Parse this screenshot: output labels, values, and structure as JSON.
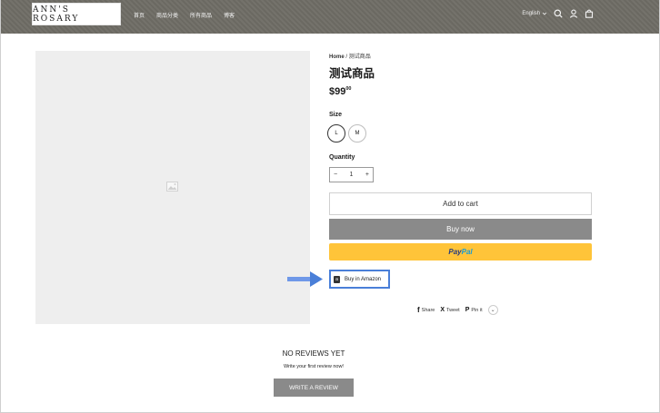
{
  "header": {
    "logo": "ANN'S ROSARY",
    "nav": [
      "首页",
      "商品分类",
      "所有商品",
      "博客"
    ],
    "language": "English",
    "icons": [
      "search-icon",
      "account-icon",
      "cart-icon"
    ]
  },
  "breadcrumb": {
    "home": "Home",
    "separator": "/",
    "current": "测试商品"
  },
  "product": {
    "title": "测试商品",
    "price_main": "$99",
    "price_cents": "00",
    "size_label": "Size",
    "sizes": [
      "L",
      "M"
    ],
    "selected_size": "L",
    "quantity_label": "Quantity",
    "qty_minus": "−",
    "qty_plus": "+",
    "quantity": "1"
  },
  "buttons": {
    "add_to_cart": "Add to cart",
    "buy_now": "Buy now",
    "paypal_pay": "Pay",
    "paypal_pal": "Pal",
    "amazon": "Buy in Amazon"
  },
  "share": {
    "share": "Share",
    "tweet": "Tweet",
    "pin": "Pin it",
    "more": "⌄"
  },
  "reviews": {
    "title": "NO REVIEWS YET",
    "subtitle": "Write your first review now!",
    "button": "WRITE A REVIEW"
  },
  "colors": {
    "header_bg": "#6f6d66",
    "buy_now_bg": "#8a8a8a",
    "paypal_bg": "#ffc439",
    "highlight": "#4a7fd8"
  }
}
